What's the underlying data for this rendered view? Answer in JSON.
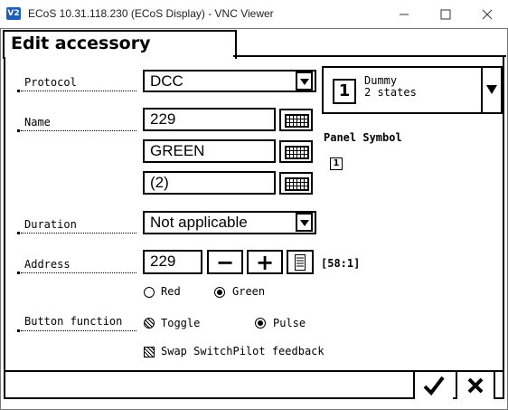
{
  "window": {
    "app_icon_text": "V2",
    "title": "ECoS 10.31.118.230 (ECoS Display) - VNC Viewer",
    "controls": [
      "minimize-icon",
      "maximize-icon",
      "close-icon"
    ]
  },
  "dialog": {
    "tab_title": "Edit accessory",
    "protocol": {
      "label": "Protocol",
      "value": "DCC"
    },
    "name": {
      "label": "Name",
      "lines": [
        "229",
        "GREEN",
        "(2)"
      ]
    },
    "duration": {
      "label": "Duration",
      "value": "Not applicable"
    },
    "address": {
      "label": "Address",
      "value": "229",
      "minus": "−",
      "plus": "+",
      "port": "[58:1]"
    },
    "address_state": {
      "options": [
        "Red",
        "Green"
      ],
      "selected": "Green"
    },
    "button_function": {
      "label": "Button function",
      "options": [
        "Toggle",
        "Pulse"
      ],
      "selected": "Pulse"
    },
    "swap_feedback": {
      "label": "Swap SwitchPilot feedback",
      "checked": false
    },
    "type_select": {
      "icon_number": "1",
      "line1": "Dummy",
      "line2": "2 states"
    },
    "panel_symbol": {
      "label": "Panel Symbol",
      "symbol": "1"
    },
    "ok_icon": "checkmark-icon",
    "cancel_icon": "x-icon"
  }
}
